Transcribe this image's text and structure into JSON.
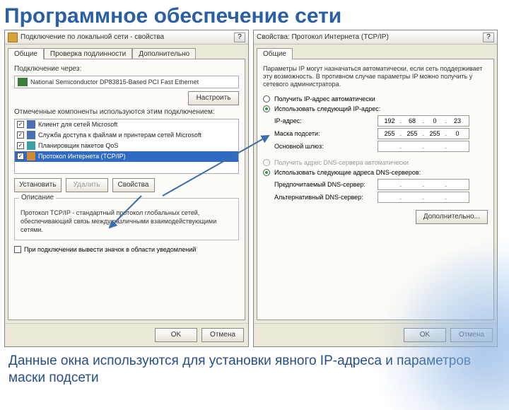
{
  "slide": {
    "title": "Программное обеспечение сети",
    "caption": "Данные окна используются для установки явного IP-адреса и параметров маски подсети"
  },
  "left": {
    "titlebar": "Подключение по локальной сети - свойства",
    "tabs": [
      "Общие",
      "Проверка подлинности",
      "Дополнительно"
    ],
    "connect_via_label": "Подключение через:",
    "adapter": "National Semiconductor DP83815-Based PCI Fast Ethernet",
    "configure_btn": "Настроить",
    "components_label": "Отмеченные компоненты используются этим подключением:",
    "items": [
      "Клиент для сетей Microsoft",
      "Служба доступа к файлам и принтерам сетей Microsoft",
      "Планировщик пакетов QoS",
      "Протокол Интернета (TCP/IP)"
    ],
    "install_btn": "Установить",
    "remove_btn": "Удалить",
    "props_btn": "Свойства",
    "desc_legend": "Описание",
    "desc_text": "Протокол TCP/IP - стандартный протокол глобальных сетей, обеспечивающий связь между различными взаимодействующими сетями.",
    "notify_chk": "При подключении вывести значок в области уведомлений",
    "ok": "OK",
    "cancel": "Отмена"
  },
  "right": {
    "titlebar": "Свойства: Протокол Интернета (TCP/IP)",
    "tabs": [
      "Общие"
    ],
    "intro": "Параметры IP могут назначаться автоматически, если сеть поддерживает эту возможность. В противном случае параметры IP можно получить у сетевого администратора.",
    "radio_auto_ip": "Получить IP-адрес автоматически",
    "radio_manual_ip": "Использовать следующий IP-адрес:",
    "ip_label": "IP-адрес:",
    "ip": [
      "192",
      "68",
      "0",
      "23"
    ],
    "mask_label": "Маска подсети:",
    "mask": [
      "255",
      "255",
      "255",
      "0"
    ],
    "gw_label": "Основной шлюз:",
    "gw": [
      "",
      "",
      "",
      ""
    ],
    "radio_auto_dns": "Получить адрес DNS-сервера автоматически",
    "radio_manual_dns": "Использовать следующие адреса DNS-серверов:",
    "dns1_label": "Предпочитаемый DNS-сервер:",
    "dns2_label": "Альтернативный DNS-сервер:",
    "advanced_btn": "Дополнительно...",
    "ok": "OK",
    "cancel": "Отмена"
  }
}
